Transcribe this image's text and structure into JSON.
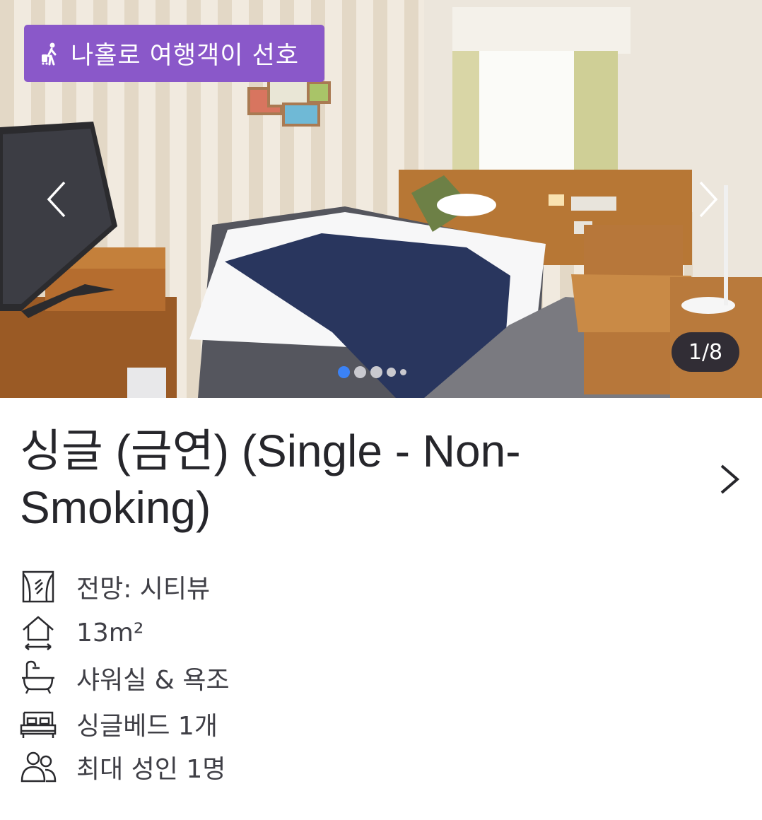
{
  "gallery": {
    "badge_label": "나홀로 여행객이 선호",
    "badge_icon": "solo-traveler-icon",
    "counter": "1/8",
    "current_slide": 1,
    "dots_visible": 5,
    "prev_icon": "chevron-left-icon",
    "next_icon": "chevron-right-icon",
    "badge_color": "#8a58c9",
    "active_dot_color": "#3b82f6"
  },
  "room": {
    "title": "싱글 (금연) (Single - Non-Smoking)",
    "detail_icon": "chevron-right-icon"
  },
  "features": [
    {
      "icon": "city-view-icon",
      "label": "전망: 시티뷰"
    },
    {
      "icon": "room-size-icon",
      "label": "13m²"
    },
    {
      "icon": "bathtub-icon",
      "label": "샤워실 & 욕조"
    },
    {
      "icon": "bed-icon",
      "label": "싱글베드 1개"
    },
    {
      "icon": "guests-icon",
      "label": "최대 성인 1명"
    }
  ]
}
